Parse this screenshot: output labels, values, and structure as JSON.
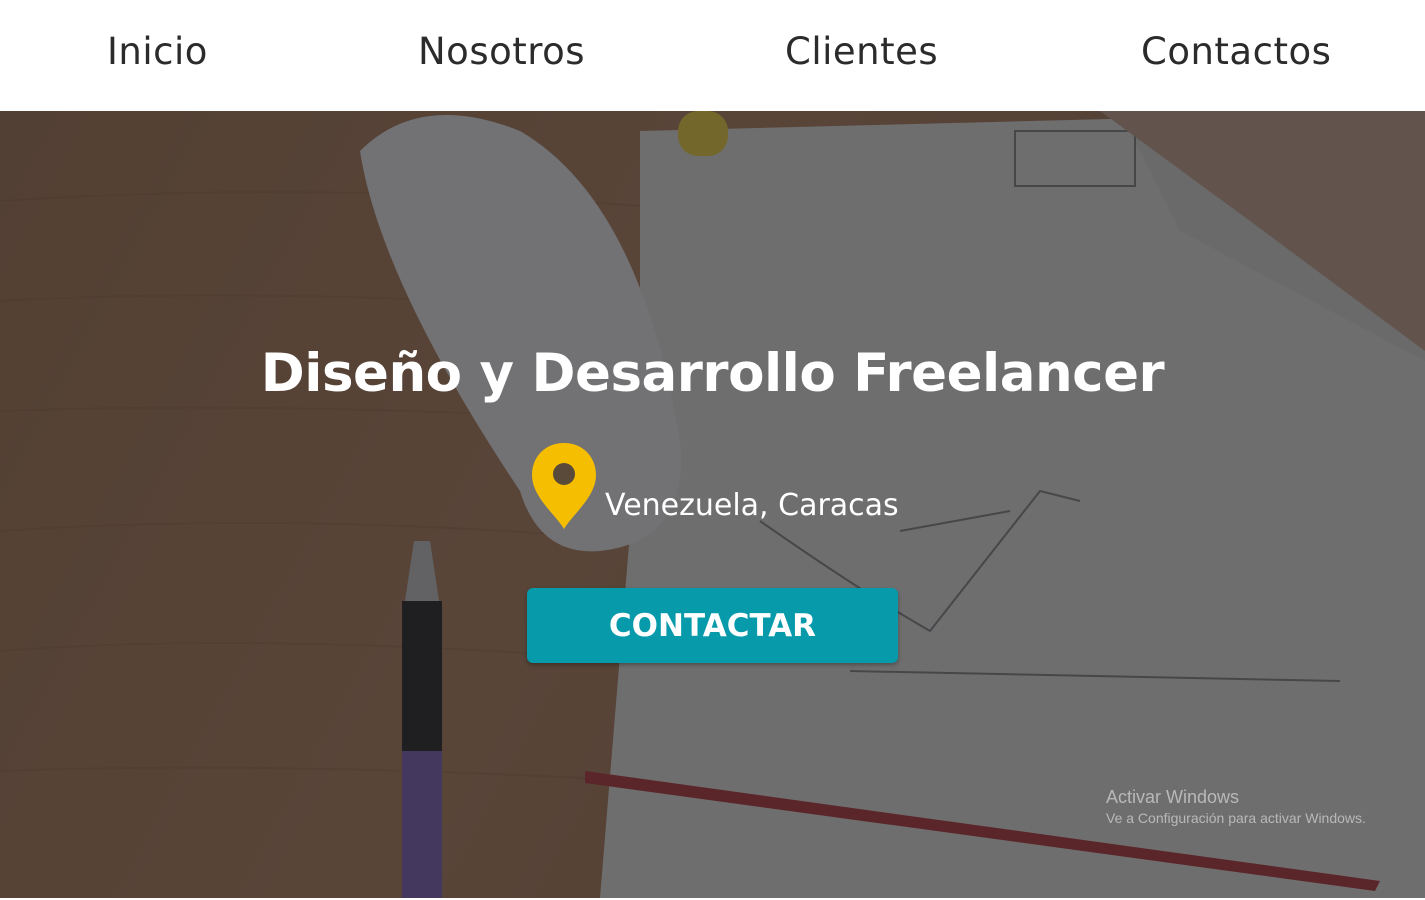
{
  "nav": {
    "items": [
      {
        "label": "Inicio"
      },
      {
        "label": "Nosotros"
      },
      {
        "label": "Clientes"
      },
      {
        "label": "Contactos"
      }
    ]
  },
  "hero": {
    "title": "Diseño y Desarrollo Freelancer",
    "location": {
      "icon": "map-pin-icon",
      "icon_color": "#f6be00",
      "text": "Venezuela, Caracas"
    },
    "cta_label": "CONTACTAR",
    "cta_color": "#069aab",
    "background": "desk-photo-dark-overlay"
  },
  "watermark": {
    "title": "Activar Windows",
    "subtitle": "Ve a Configuración para activar Windows."
  }
}
